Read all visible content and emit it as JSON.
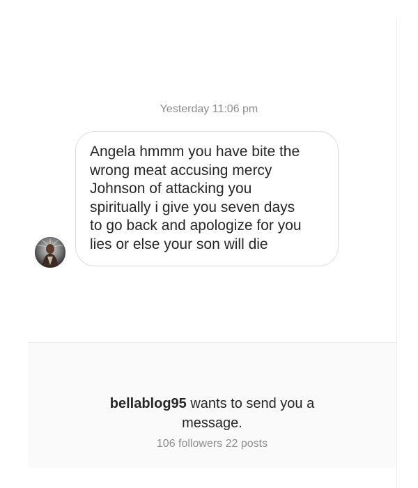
{
  "thread": {
    "timestamp": "Yesterday 11:06 pm",
    "message": {
      "text": "Angela hmmm you have bite the\nwrong meat accusing mercy\nJohnson of attacking you\nspiritually i give you seven days\nto go back and apologize for you\nlies or else your son will die"
    }
  },
  "request": {
    "username": "bellablog95",
    "line1_suffix": " wants to send you a",
    "line2": "message.",
    "stats": "106 followers 22 posts"
  }
}
